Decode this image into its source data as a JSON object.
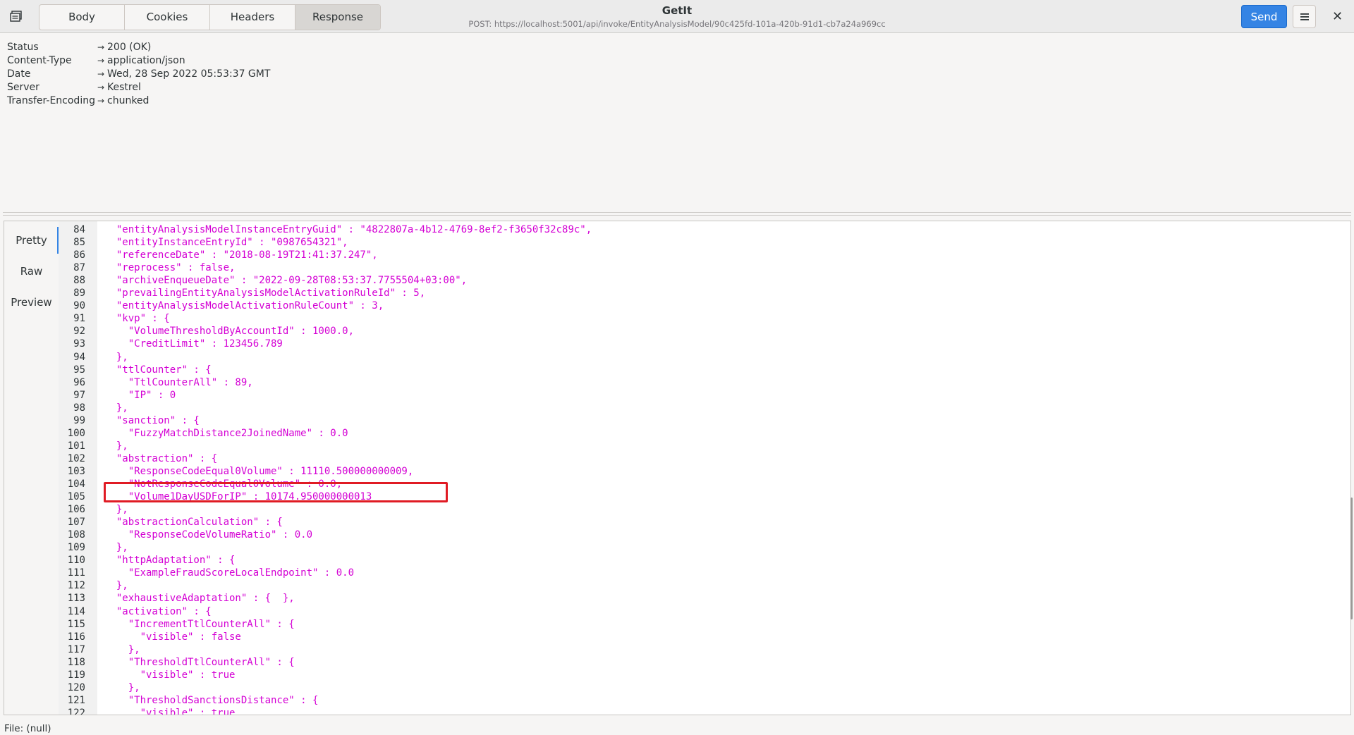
{
  "header": {
    "tabs": [
      "Body",
      "Cookies",
      "Headers",
      "Response"
    ],
    "active_tab": "Response",
    "title": "GetIt",
    "subtitle": "POST: https://localhost:5001/api/invoke/EntityAnalysisModel/90c425fd-101a-420b-91d1-cb7a24a969cc",
    "send_label": "Send",
    "menu_icon": "hamburger-menu-icon",
    "close_label": "✕"
  },
  "response_headers": [
    {
      "key": "Status",
      "value": "200 (OK)"
    },
    {
      "key": "Content-Type",
      "value": "application/json"
    },
    {
      "key": "Date",
      "value": "Wed, 28 Sep 2022 05:53:37 GMT"
    },
    {
      "key": "Server",
      "value": "Kestrel"
    },
    {
      "key": "Transfer-Encoding",
      "value": "chunked"
    }
  ],
  "arrow": "→",
  "body_view": {
    "modes": [
      "Pretty",
      "Raw",
      "Preview"
    ],
    "active_mode": "Pretty",
    "highlighted_line": 105,
    "lines": [
      {
        "n": "84",
        "t": "  \"entityAnalysisModelInstanceEntryGuid\" : \"4822807a-4b12-4769-8ef2-f3650f32c89c\","
      },
      {
        "n": "85",
        "t": "  \"entityInstanceEntryId\" : \"0987654321\","
      },
      {
        "n": "86",
        "t": "  \"referenceDate\" : \"2018-08-19T21:41:37.247\","
      },
      {
        "n": "87",
        "t": "  \"reprocess\" : false,"
      },
      {
        "n": "88",
        "t": "  \"archiveEnqueueDate\" : \"2022-09-28T08:53:37.7755504+03:00\","
      },
      {
        "n": "89",
        "t": "  \"prevailingEntityAnalysisModelActivationRuleId\" : 5,"
      },
      {
        "n": "90",
        "t": "  \"entityAnalysisModelActivationRuleCount\" : 3,"
      },
      {
        "n": "91",
        "t": "  \"kvp\" : {"
      },
      {
        "n": "92",
        "t": "    \"VolumeThresholdByAccountId\" : 1000.0,"
      },
      {
        "n": "93",
        "t": "    \"CreditLimit\" : 123456.789"
      },
      {
        "n": "94",
        "t": "  },"
      },
      {
        "n": "95",
        "t": "  \"ttlCounter\" : {"
      },
      {
        "n": "96",
        "t": "    \"TtlCounterAll\" : 89,"
      },
      {
        "n": "97",
        "t": "    \"IP\" : 0"
      },
      {
        "n": "98",
        "t": "  },"
      },
      {
        "n": "99",
        "t": "  \"sanction\" : {"
      },
      {
        "n": "100",
        "t": "    \"FuzzyMatchDistance2JoinedName\" : 0.0"
      },
      {
        "n": "101",
        "t": "  },"
      },
      {
        "n": "102",
        "t": "  \"abstraction\" : {"
      },
      {
        "n": "103",
        "t": "    \"ResponseCodeEqual0Volume\" : 11110.500000000009,"
      },
      {
        "n": "104",
        "t": "    \"NotResponseCodeEqual0Volume\" : 0.0,"
      },
      {
        "n": "105",
        "t": "    \"Volume1DayUSDForIP\" : 10174.950000000013"
      },
      {
        "n": "106",
        "t": "  },"
      },
      {
        "n": "107",
        "t": "  \"abstractionCalculation\" : {"
      },
      {
        "n": "108",
        "t": "    \"ResponseCodeVolumeRatio\" : 0.0"
      },
      {
        "n": "109",
        "t": "  },"
      },
      {
        "n": "110",
        "t": "  \"httpAdaptation\" : {"
      },
      {
        "n": "111",
        "t": "    \"ExampleFraudScoreLocalEndpoint\" : 0.0"
      },
      {
        "n": "112",
        "t": "  },"
      },
      {
        "n": "113",
        "t": "  \"exhaustiveAdaptation\" : {  },"
      },
      {
        "n": "114",
        "t": "  \"activation\" : {"
      },
      {
        "n": "115",
        "t": "    \"IncrementTtlCounterAll\" : {"
      },
      {
        "n": "116",
        "t": "      \"visible\" : false"
      },
      {
        "n": "117",
        "t": "    },"
      },
      {
        "n": "118",
        "t": "    \"ThresholdTtlCounterAll\" : {"
      },
      {
        "n": "119",
        "t": "      \"visible\" : true"
      },
      {
        "n": "120",
        "t": "    },"
      },
      {
        "n": "121",
        "t": "    \"ThresholdSanctionsDistance\" : {"
      },
      {
        "n": "122",
        "t": "      \"visible\" : true"
      }
    ]
  },
  "status_bar": "File: (null)"
}
